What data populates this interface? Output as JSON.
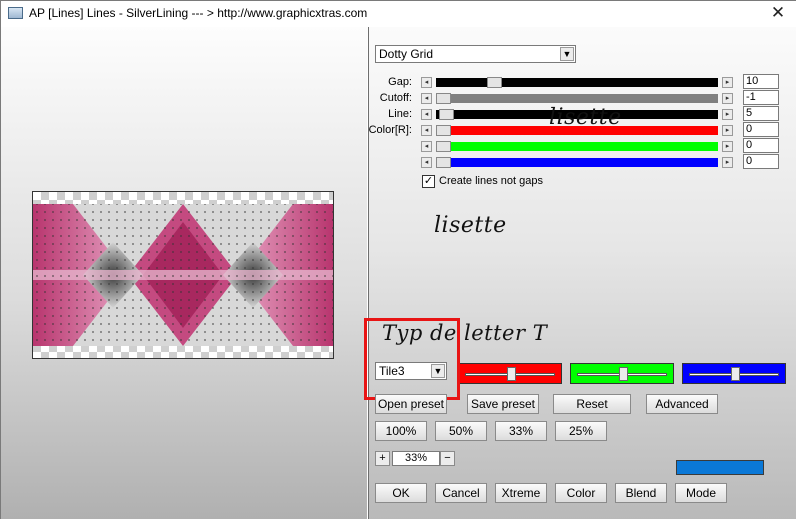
{
  "window": {
    "title": "AP [Lines]  Lines - SilverLining     --- > http://www.graphicxtras.com",
    "close_glyph": "✕"
  },
  "preset": {
    "selected": "Dotty Grid"
  },
  "sliders": [
    {
      "label": "Gap:",
      "value": "10",
      "level": 0.19,
      "color": "#000000"
    },
    {
      "label": "Cutoff:",
      "value": "-1",
      "level": 0.0,
      "color": "#808080"
    },
    {
      "label": "Line:",
      "value": "5",
      "level": 0.01,
      "color": "#000000"
    },
    {
      "label": "Color[R]:",
      "value": "0",
      "level": 0.0,
      "color": "#ff0000"
    },
    {
      "label": "",
      "value": "0",
      "level": 0.0,
      "color": "#00ff00"
    },
    {
      "label": "",
      "value": "0",
      "level": 0.0,
      "color": "#0000ff"
    }
  ],
  "option": {
    "checked": true,
    "label": "Create lines not gaps"
  },
  "watermarks": {
    "top": "lisette",
    "middle": "lisette",
    "note": "Typ de letter T"
  },
  "tile": {
    "selected": "Tile3"
  },
  "color_boxes": [
    {
      "color": "#ff0000",
      "level": 0.5
    },
    {
      "color": "#00ff00",
      "level": 0.5
    },
    {
      "color": "#0000ff",
      "level": 0.5
    }
  ],
  "buttons_row1": [
    "Open preset",
    "Save preset",
    "Reset",
    "Advanced"
  ],
  "buttons_row2": [
    "100%",
    "50%",
    "33%",
    "25%"
  ],
  "zoom": {
    "minus": "−",
    "plus": "+",
    "value": "33%"
  },
  "buttons_bottom": [
    "OK",
    "Cancel",
    "Xtreme",
    "Color",
    "Blend",
    "Mode"
  ],
  "swatch": {
    "color": "#0a78d7"
  },
  "icons": [
    "app-icon",
    "close-icon",
    "chevron-down-icon",
    "arrow-left-icon",
    "arrow-right-icon",
    "checkbox-check-icon"
  ]
}
